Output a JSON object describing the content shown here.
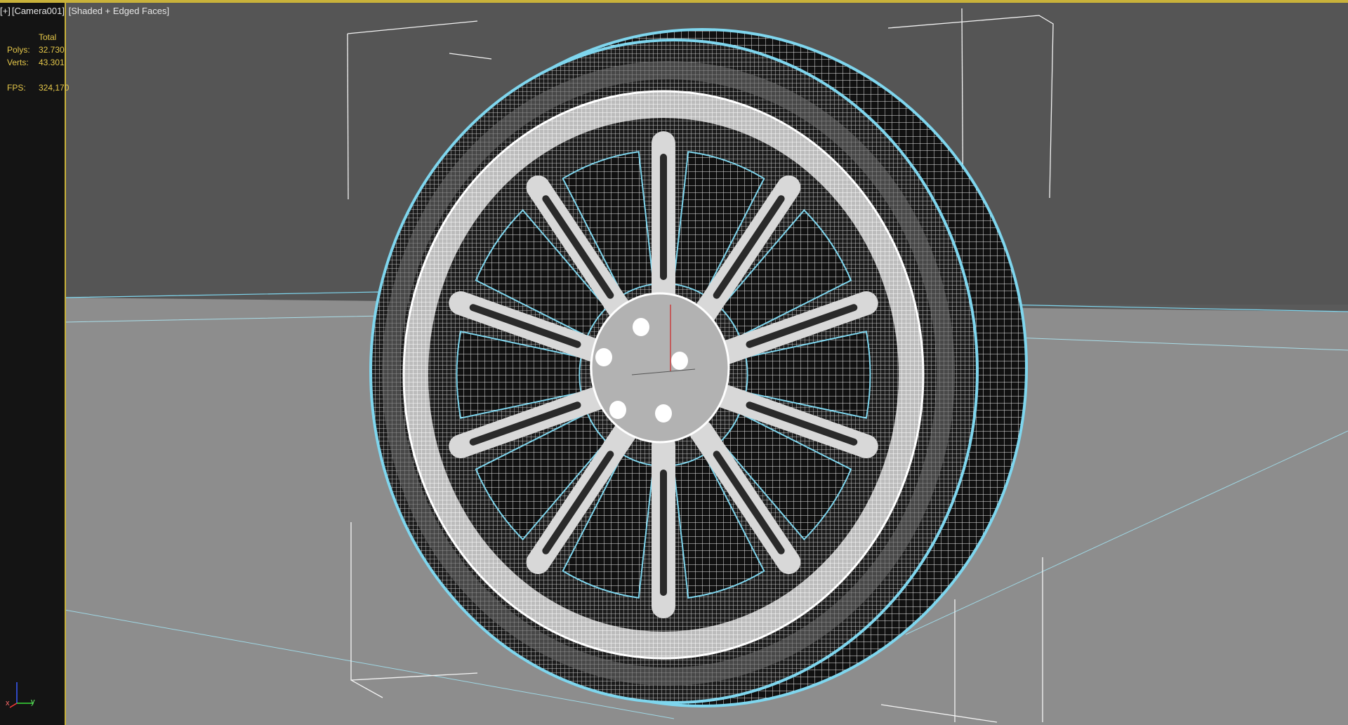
{
  "viewport": {
    "label_parts": [
      "[+]",
      "[Camera001]",
      "[Shaded + Edged Faces]"
    ]
  },
  "stats": {
    "header": "Total",
    "polys_label": "Polys:",
    "polys_value": "32.730",
    "verts_label": "Verts:",
    "verts_value": "43.301",
    "fps_label": "FPS:",
    "fps_value": "324,170"
  },
  "gizmo": {
    "x_label": "x",
    "y_label": "y"
  },
  "colors": {
    "active_border": "#c9b23a",
    "selection_outline": "#7fd6ee",
    "wireframe": "#ffffff",
    "viewport_bg": "#5a5a5a"
  }
}
